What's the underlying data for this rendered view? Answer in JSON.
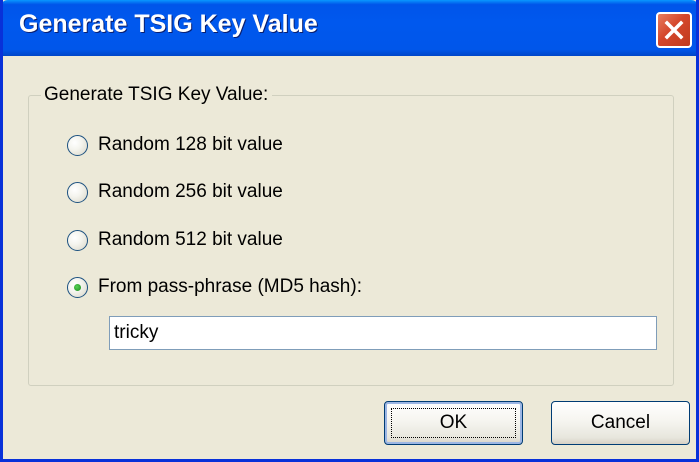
{
  "window": {
    "title": "Generate TSIG Key Value",
    "close_icon": "close-icon"
  },
  "group": {
    "label": "Generate TSIG Key Value:"
  },
  "options": [
    {
      "label": "Random 128 bit value",
      "selected": false
    },
    {
      "label": "Random 256 bit value",
      "selected": false
    },
    {
      "label": "Random 512 bit value",
      "selected": false
    },
    {
      "label": "From pass-phrase (MD5 hash):",
      "selected": true
    }
  ],
  "passphrase": {
    "value": "tricky"
  },
  "buttons": {
    "ok_label": "OK",
    "cancel_label": "Cancel"
  },
  "colors": {
    "title_bar": "#0058ee",
    "close_button": "#d4472c",
    "dialog_background": "#ece9d8",
    "radio_selected_dot": "#21a121"
  }
}
